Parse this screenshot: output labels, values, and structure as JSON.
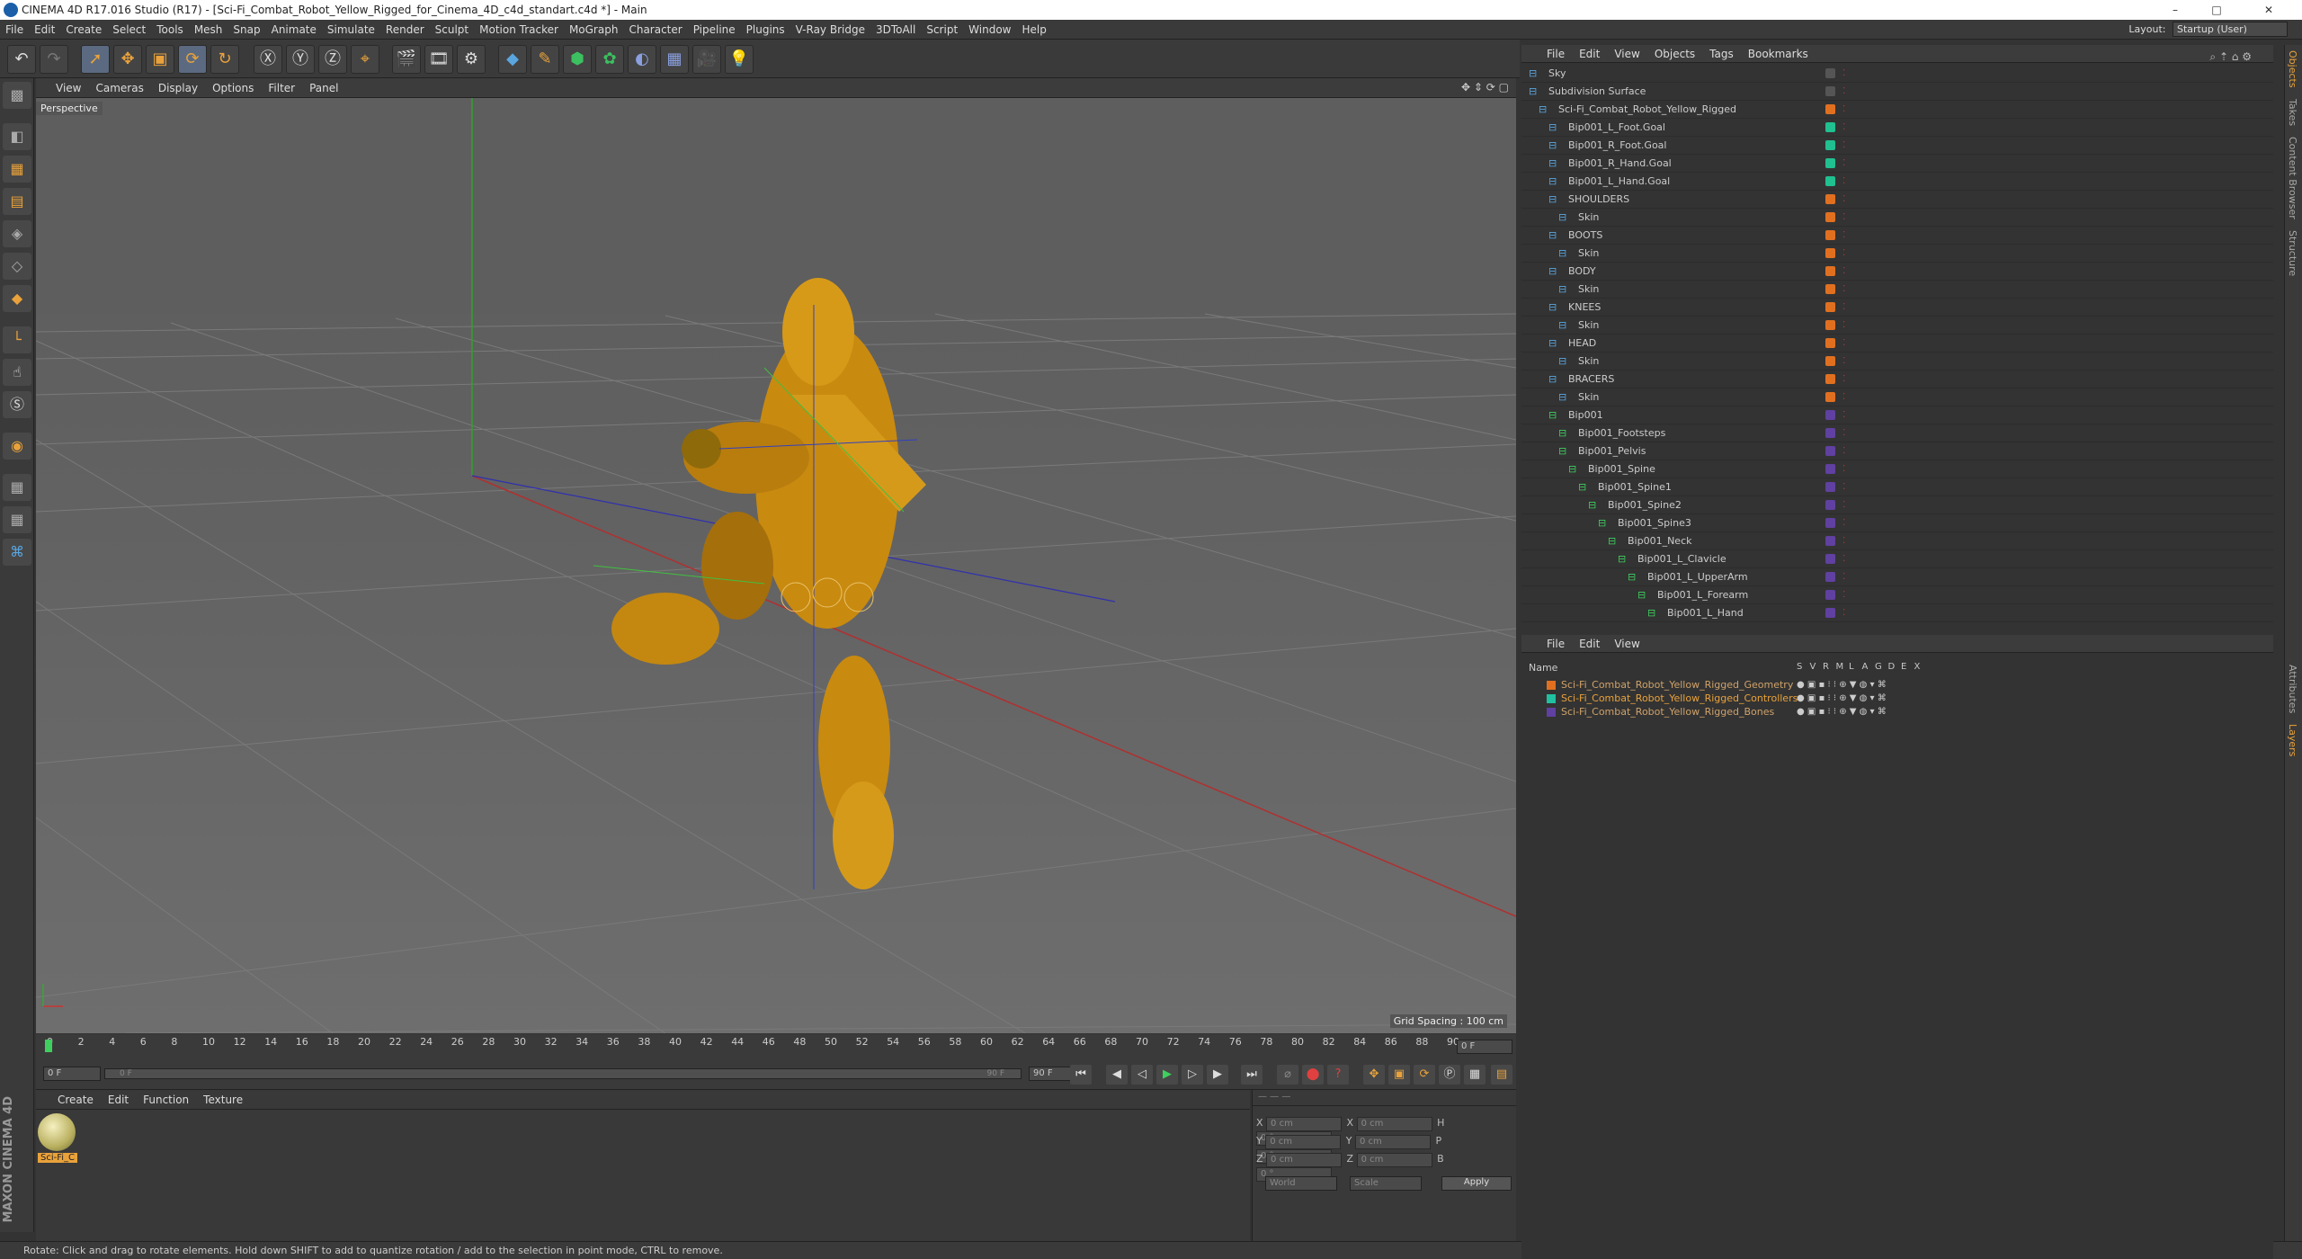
{
  "window": {
    "title": "CINEMA 4D R17.016 Studio (R17) - [Sci-Fi_Combat_Robot_Yellow_Rigged_for_Cinema_4D_c4d_standart.c4d *] - Main",
    "minimize": "–",
    "maximize": "□",
    "close": "✕"
  },
  "menu": {
    "items": [
      "File",
      "Edit",
      "Create",
      "Select",
      "Tools",
      "Mesh",
      "Snap",
      "Animate",
      "Simulate",
      "Render",
      "Sculpt",
      "Motion Tracker",
      "MoGraph",
      "Character",
      "Pipeline",
      "Plugins",
      "V-Ray Bridge",
      "3DToAll",
      "Script",
      "Window",
      "Help"
    ],
    "layout_label": "Layout:",
    "layout_value": "Startup (User)"
  },
  "viewport": {
    "menu": [
      "View",
      "Cameras",
      "Display",
      "Options",
      "Filter",
      "Panel"
    ],
    "label": "Perspective",
    "grid_spacing": "Grid Spacing : 100 cm"
  },
  "timeline": {
    "ticks": [
      "0",
      "2",
      "4",
      "6",
      "8",
      "10",
      "12",
      "14",
      "16",
      "18",
      "20",
      "22",
      "24",
      "26",
      "28",
      "30",
      "32",
      "34",
      "36",
      "38",
      "40",
      "42",
      "44",
      "46",
      "48",
      "50",
      "52",
      "54",
      "56",
      "58",
      "60",
      "62",
      "64",
      "66",
      "68",
      "70",
      "72",
      "74",
      "76",
      "78",
      "80",
      "82",
      "84",
      "86",
      "88",
      "90"
    ],
    "current_frame": "0 F",
    "start": "0 F",
    "range_label": "0 F",
    "range_end": "90 F",
    "end": "90 F"
  },
  "material": {
    "menu": [
      "Create",
      "Edit",
      "Function",
      "Texture"
    ],
    "name": "Sci-Fi_C"
  },
  "coords": {
    "rows": [
      {
        "a": "X",
        "v1": "0 cm",
        "b": "X",
        "v2": "0 cm",
        "c": "H",
        "v3": "0 °"
      },
      {
        "a": "Y",
        "v1": "0 cm",
        "b": "Y",
        "v2": "0 cm",
        "c": "P",
        "v3": "0 °"
      },
      {
        "a": "Z",
        "v1": "0 cm",
        "b": "Z",
        "v2": "0 cm",
        "c": "B",
        "v3": "0 °"
      }
    ],
    "world": "World",
    "scale": "Scale",
    "apply": "Apply"
  },
  "status": "Rotate: Click and drag to rotate elements. Hold down SHIFT to add to quantize rotation / add to the selection in point mode, CTRL to remove.",
  "objects": {
    "menu": [
      "File",
      "Edit",
      "View",
      "Objects",
      "Tags",
      "Bookmarks"
    ],
    "rows": [
      {
        "name": "Sky",
        "indent": 0,
        "color": "#555"
      },
      {
        "name": "Subdivision Surface",
        "indent": 0,
        "color": "#555"
      },
      {
        "name": "Sci-Fi_Combat_Robot_Yellow_Rigged",
        "indent": 1,
        "color": "#e07020"
      },
      {
        "name": "Bip001_L_Foot.Goal",
        "indent": 2,
        "color": "#20c090"
      },
      {
        "name": "Bip001_R_Foot.Goal",
        "indent": 2,
        "color": "#20c090"
      },
      {
        "name": "Bip001_R_Hand.Goal",
        "indent": 2,
        "color": "#20c090"
      },
      {
        "name": "Bip001_L_Hand.Goal",
        "indent": 2,
        "color": "#20c090"
      },
      {
        "name": "SHOULDERS",
        "indent": 2,
        "color": "#e07020"
      },
      {
        "name": "Skin",
        "indent": 3,
        "color": "#e07020"
      },
      {
        "name": "BOOTS",
        "indent": 2,
        "color": "#e07020"
      },
      {
        "name": "Skin",
        "indent": 3,
        "color": "#e07020"
      },
      {
        "name": "BODY",
        "indent": 2,
        "color": "#e07020"
      },
      {
        "name": "Skin",
        "indent": 3,
        "color": "#e07020"
      },
      {
        "name": "KNEES",
        "indent": 2,
        "color": "#e07020"
      },
      {
        "name": "Skin",
        "indent": 3,
        "color": "#e07020"
      },
      {
        "name": "HEAD",
        "indent": 2,
        "color": "#e07020"
      },
      {
        "name": "Skin",
        "indent": 3,
        "color": "#e07020"
      },
      {
        "name": "BRACERS",
        "indent": 2,
        "color": "#e07020"
      },
      {
        "name": "Skin",
        "indent": 3,
        "color": "#e07020"
      },
      {
        "name": "Bip001",
        "indent": 2,
        "color": "#6040a0"
      },
      {
        "name": "Bip001_Footsteps",
        "indent": 3,
        "color": "#6040a0"
      },
      {
        "name": "Bip001_Pelvis",
        "indent": 3,
        "color": "#6040a0"
      },
      {
        "name": "Bip001_Spine",
        "indent": 4,
        "color": "#6040a0"
      },
      {
        "name": "Bip001_Spine1",
        "indent": 5,
        "color": "#6040a0"
      },
      {
        "name": "Bip001_Spine2",
        "indent": 6,
        "color": "#6040a0"
      },
      {
        "name": "Bip001_Spine3",
        "indent": 7,
        "color": "#6040a0"
      },
      {
        "name": "Bip001_Neck",
        "indent": 8,
        "color": "#6040a0"
      },
      {
        "name": "Bip001_L_Clavicle",
        "indent": 9,
        "color": "#6040a0"
      },
      {
        "name": "Bip001_L_UpperArm",
        "indent": 10,
        "color": "#6040a0"
      },
      {
        "name": "Bip001_L_Forearm",
        "indent": 11,
        "color": "#6040a0"
      },
      {
        "name": "Bip001_L_Hand",
        "indent": 12,
        "color": "#6040a0"
      }
    ]
  },
  "layers": {
    "menu": [
      "File",
      "Edit",
      "View"
    ],
    "header": "Name",
    "cols": [
      "S",
      "V",
      "R",
      "M",
      "L",
      "A",
      "G",
      "D",
      "E",
      "X"
    ],
    "rows": [
      {
        "name": "Sci-Fi_Combat_Robot_Yellow_Rigged_Geometry",
        "color": "#e07020",
        "text": "#cfa26a"
      },
      {
        "name": "Sci-Fi_Combat_Robot_Yellow_Rigged_Controllers",
        "color": "#20c0a0",
        "text": "#e9a23b"
      },
      {
        "name": "Sci-Fi_Combat_Robot_Yellow_Rigged_Bones",
        "color": "#6040a0",
        "text": "#cfa26a"
      }
    ]
  },
  "sidetabs": [
    "Objects",
    "Takes",
    "Content Browser",
    "Structure",
    "Attributes",
    "Layers"
  ]
}
